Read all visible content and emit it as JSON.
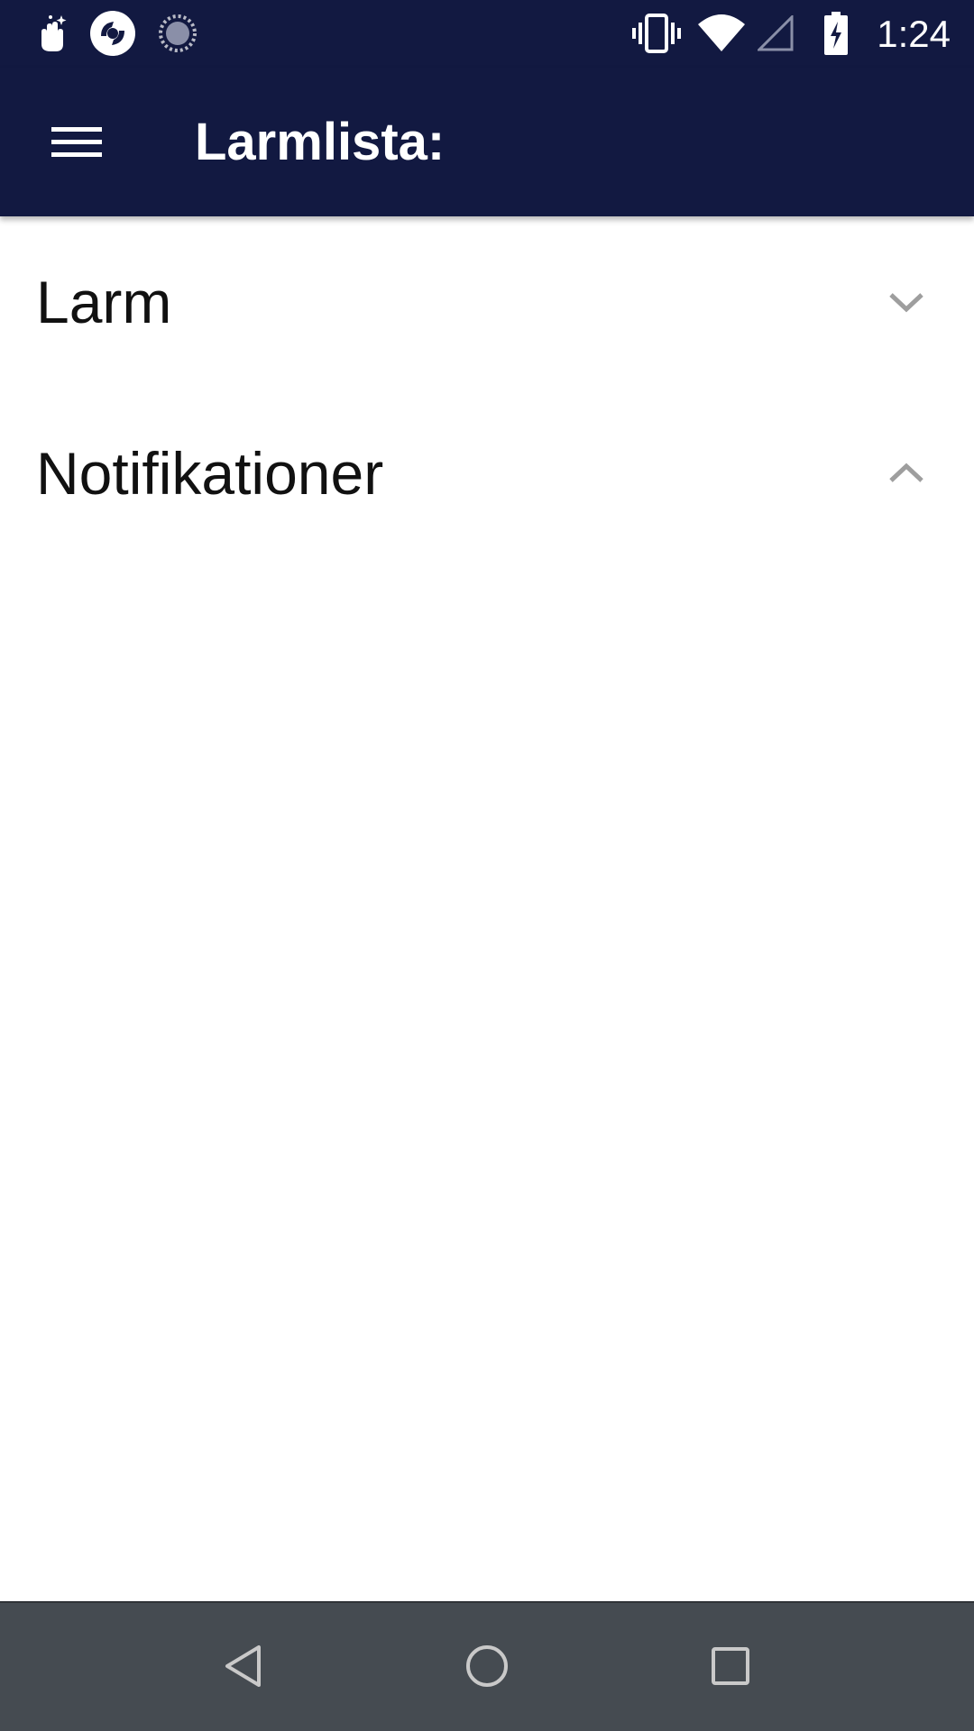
{
  "status_bar": {
    "time": "1:24",
    "left_icons": [
      "gesture-icon",
      "sync-app-icon",
      "loading-icon"
    ],
    "right_icons": [
      "vibrate-icon",
      "wifi-icon",
      "cell-signal-icon",
      "battery-charging-icon"
    ]
  },
  "app_bar": {
    "menu_icon": "hamburger-menu-icon",
    "title": "Larmlista:",
    "background": "#121941"
  },
  "sections": [
    {
      "label": "Larm",
      "expanded": false,
      "chevron": "chevron-down-icon"
    },
    {
      "label": "Notifikationer",
      "expanded": true,
      "chevron": "chevron-up-icon"
    }
  ],
  "nav_bar": {
    "buttons": [
      "back-icon",
      "home-icon",
      "recents-icon"
    ],
    "background": "#454b51"
  }
}
